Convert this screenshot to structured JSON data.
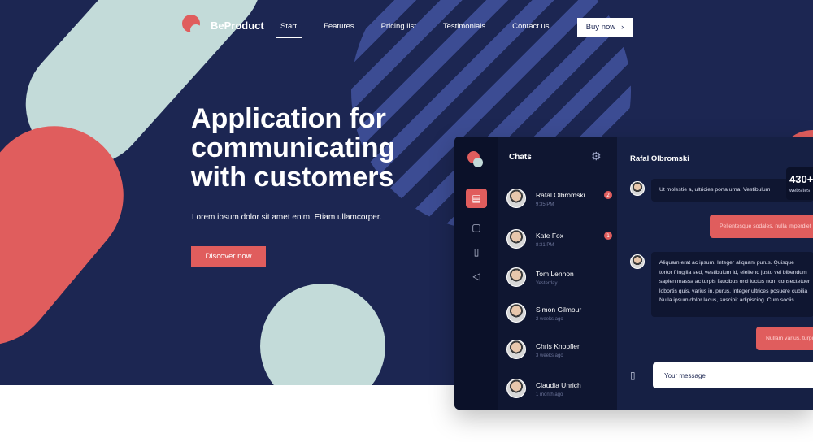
{
  "brand": {
    "name": "BeProduct"
  },
  "nav": {
    "items": [
      "Start",
      "Features",
      "Pricing list",
      "Testimonials",
      "Contact us"
    ],
    "active_index": 0,
    "buy_label": "Buy now",
    "buy_icon": "chevron-right-icon"
  },
  "hero": {
    "headline": [
      "Application for",
      "communicating",
      "with customers"
    ],
    "subline": "Lorem ipsum dolor sit amet enim. Etiam ullamcorper.",
    "cta_label": "Discover now"
  },
  "colors": {
    "navy": "#1c2652",
    "coral": "#e05d5d",
    "mint": "#c3dbd9",
    "stripe": "#3c4c93",
    "app_dark": "#0f1631"
  },
  "app": {
    "chats_title": "Chats",
    "rail_icons": [
      "chat-icon",
      "contacts-icon",
      "phone-icon",
      "megaphone-icon"
    ],
    "chats": [
      {
        "name": "Rafal Olbromski",
        "time": "9:35 PM",
        "badge": "2"
      },
      {
        "name": "Kate Fox",
        "time": "8:31 PM",
        "badge": "1"
      },
      {
        "name": "Tom Lennon",
        "time": "Yesterday",
        "badge": ""
      },
      {
        "name": "Simon Gilmour",
        "time": "2 weeks ago",
        "badge": ""
      },
      {
        "name": "Chris Knopfler",
        "time": "3 weeks ago",
        "badge": ""
      },
      {
        "name": "Claudia Unrich",
        "time": "1 month ago",
        "badge": ""
      }
    ],
    "conversation": {
      "title": "Rafal Olbromski",
      "msg1": "Ut molestie a, ultricies porta urna. Vestibulum",
      "out1": "Pellentesque sodales, nulla imperdiet",
      "msg2": [
        "Aliquam erat ac ipsum. Integer aliquam purus. Quisque",
        "tortor fringilla sed, vestibulum id, eleifend justo vel bibendum",
        "sapien massa ac turpis faucibus orci luctus non, consectetuer",
        "lobortis quis, varius in, purus. Integer ultrices posuere cubilia",
        "Nulla ipsum dolor lacus, suscipit adipiscing. Cum sociis"
      ],
      "out2": "Nullam varius, turpis",
      "stat_number": "430+",
      "stat_label": "websites",
      "input_placeholder": "Your message"
    }
  }
}
